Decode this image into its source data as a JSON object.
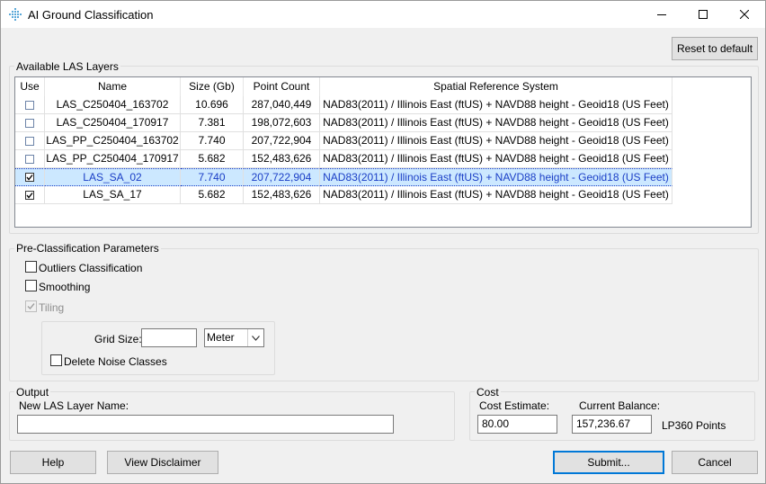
{
  "window": {
    "title": "AI Ground Classification"
  },
  "toolbar": {
    "reset_label": "Reset to default"
  },
  "layers": {
    "group_label": "Available LAS Layers",
    "columns": [
      "Use",
      "Name",
      "Size (Gb)",
      "Point Count",
      "Spatial Reference System"
    ],
    "rows": [
      {
        "use": false,
        "name": "LAS_C250404_163702",
        "size": "10.696",
        "points": "287,040,449",
        "srs": "NAD83(2011) / Illinois East (ftUS) + NAVD88 height - Geoid18 (US Feet)",
        "selected": false
      },
      {
        "use": false,
        "name": "LAS_C250404_170917",
        "size": "7.381",
        "points": "198,072,603",
        "srs": "NAD83(2011) / Illinois East (ftUS) + NAVD88 height - Geoid18 (US Feet)",
        "selected": false
      },
      {
        "use": false,
        "name": "LAS_PP_C250404_163702",
        "size": "7.740",
        "points": "207,722,904",
        "srs": "NAD83(2011) / Illinois East (ftUS) + NAVD88 height - Geoid18 (US Feet)",
        "selected": false
      },
      {
        "use": false,
        "name": "LAS_PP_C250404_170917",
        "size": "5.682",
        "points": "152,483,626",
        "srs": "NAD83(2011) / Illinois East (ftUS) + NAVD88 height - Geoid18 (US Feet)",
        "selected": false
      },
      {
        "use": true,
        "name": "LAS_SA_02",
        "size": "7.740",
        "points": "207,722,904",
        "srs": "NAD83(2011) / Illinois East (ftUS) + NAVD88 height - Geoid18 (US Feet)",
        "selected": true
      },
      {
        "use": true,
        "name": "LAS_SA_17",
        "size": "5.682",
        "points": "152,483,626",
        "srs": "NAD83(2011) / Illinois East (ftUS) + NAVD88 height - Geoid18 (US Feet)",
        "selected": false
      }
    ]
  },
  "preclass": {
    "group_label": "Pre-Classification Parameters",
    "outliers_label": "Outliers Classification",
    "outliers_checked": false,
    "smoothing_label": "Smoothing",
    "smoothing_checked": false,
    "tiling_label": "Tiling",
    "tiling_checked": true,
    "grid_size_label": "Grid Size:",
    "grid_size_value": "",
    "unit_selected": "Meter",
    "delete_noise_label": "Delete Noise Classes",
    "delete_noise_checked": false
  },
  "output": {
    "group_label": "Output",
    "layer_name_label": "New LAS Layer Name:",
    "layer_name_value": ""
  },
  "cost": {
    "group_label": "Cost",
    "estimate_label": "Cost Estimate:",
    "estimate_value": "80.00",
    "balance_label": "Current Balance:",
    "balance_value": "157,236.67",
    "unit_label": "LP360 Points"
  },
  "footer": {
    "help_label": "Help",
    "disclaimer_label": "View Disclaimer",
    "submit_label": "Submit...",
    "cancel_label": "Cancel"
  },
  "colors": {
    "accent": "#0078d7",
    "selection_bg": "#cce8ff",
    "selection_text": "#1a3ec6"
  }
}
